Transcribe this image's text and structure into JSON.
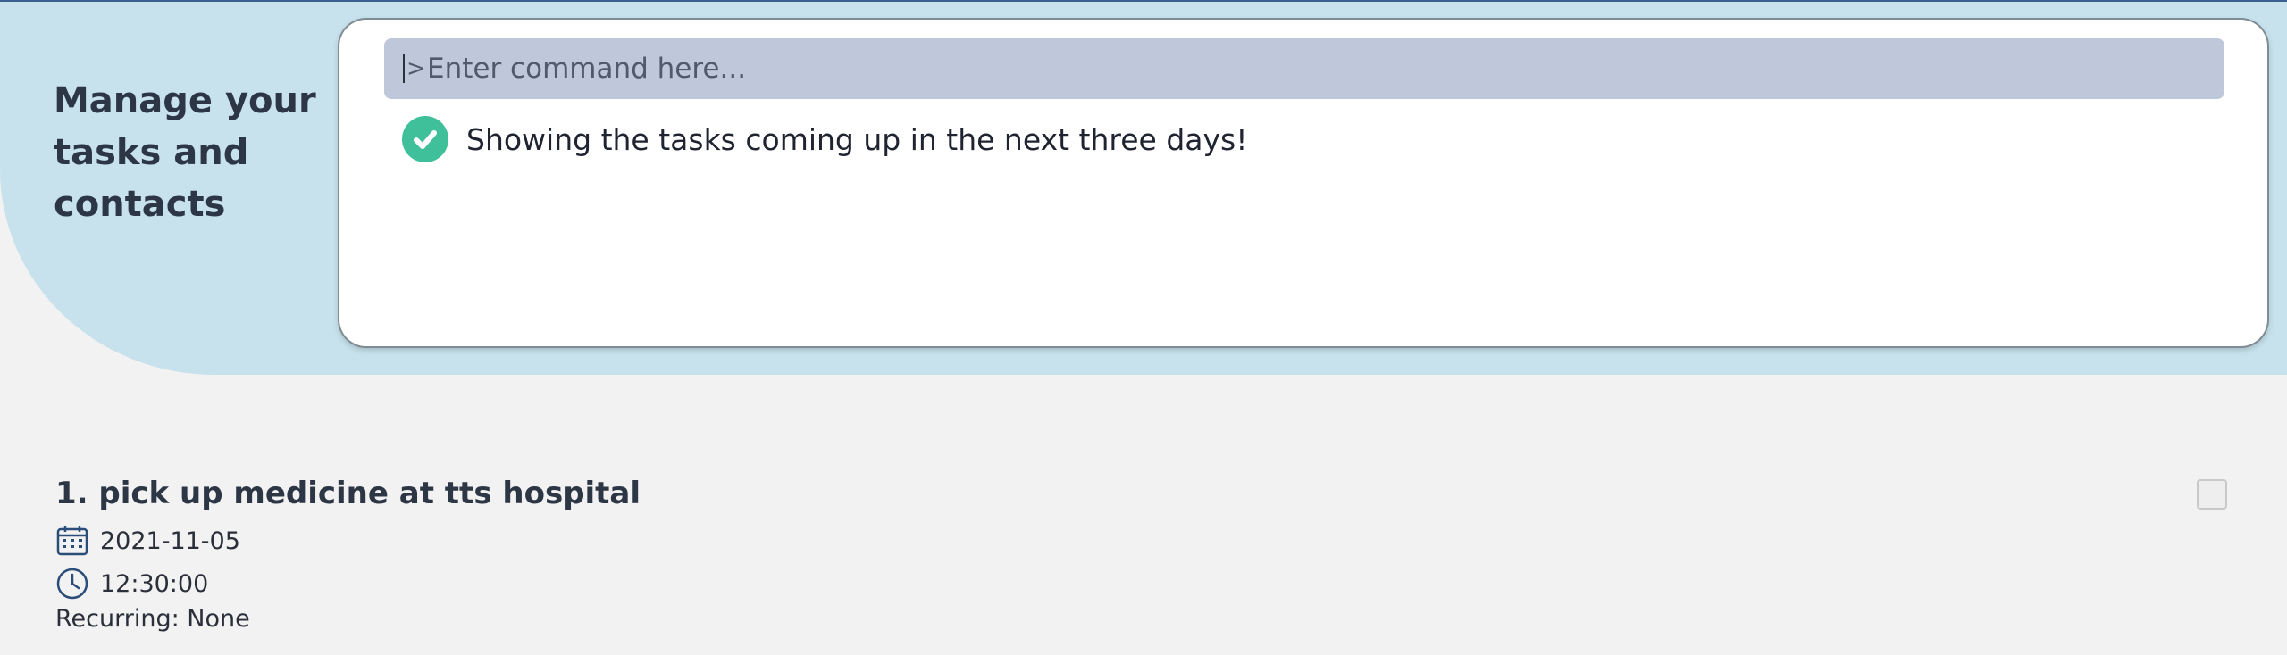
{
  "header": {
    "title": "Manage your tasks and contacts"
  },
  "command": {
    "placeholder": "Enter command here...",
    "value": ""
  },
  "result": {
    "message": "Showing the tasks coming up in the next three days!",
    "status_icon": "check-circle-icon",
    "status_color": "#3fbf9a"
  },
  "tasks": [
    {
      "title": "1. pick up medicine at tts hospital",
      "date": "2021-11-05",
      "time": "12:30:00",
      "recurring": "Recurring: None",
      "done": false
    }
  ],
  "colors": {
    "header_bg": "#c7e2ec",
    "input_bg": "#bfc8da",
    "page_bg": "#f3f2f2",
    "accent_dark": "#3b5f8f"
  }
}
